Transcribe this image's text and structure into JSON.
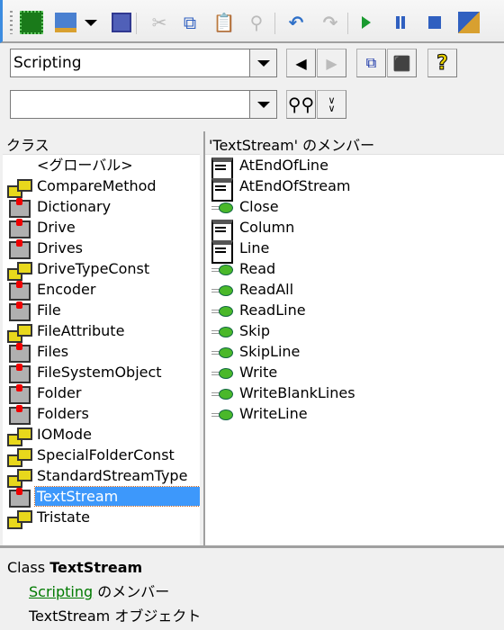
{
  "toolbar": {
    "icons": [
      "excel-icon",
      "userform-icon",
      "dropdown-icon",
      "save-icon",
      "cut-icon",
      "copy-icon",
      "paste-icon",
      "find-icon",
      "undo-icon",
      "redo-icon",
      "run-icon",
      "pause-icon",
      "stop-icon",
      "design-mode-icon"
    ]
  },
  "library_combo": {
    "value": "Scripting"
  },
  "search_combo": {
    "value": ""
  },
  "classes_header": "クラス",
  "members_header": "'TextStream' のメンバー",
  "classes": [
    {
      "label": "<グローバル>",
      "icon": "module"
    },
    {
      "label": "CompareMethod",
      "icon": "enum"
    },
    {
      "label": "Dictionary",
      "icon": "class"
    },
    {
      "label": "Drive",
      "icon": "class"
    },
    {
      "label": "Drives",
      "icon": "class"
    },
    {
      "label": "DriveTypeConst",
      "icon": "enum"
    },
    {
      "label": "Encoder",
      "icon": "class"
    },
    {
      "label": "File",
      "icon": "class"
    },
    {
      "label": "FileAttribute",
      "icon": "enum"
    },
    {
      "label": "Files",
      "icon": "class"
    },
    {
      "label": "FileSystemObject",
      "icon": "class"
    },
    {
      "label": "Folder",
      "icon": "class"
    },
    {
      "label": "Folders",
      "icon": "class"
    },
    {
      "label": "IOMode",
      "icon": "enum"
    },
    {
      "label": "SpecialFolderConst",
      "icon": "enum"
    },
    {
      "label": "StandardStreamType",
      "icon": "enum"
    },
    {
      "label": "TextStream",
      "icon": "class",
      "selected": true
    },
    {
      "label": "Tristate",
      "icon": "enum"
    }
  ],
  "members": [
    {
      "label": "AtEndOfLine",
      "icon": "prop"
    },
    {
      "label": "AtEndOfStream",
      "icon": "prop"
    },
    {
      "label": "Close",
      "icon": "meth"
    },
    {
      "label": "Column",
      "icon": "prop"
    },
    {
      "label": "Line",
      "icon": "prop"
    },
    {
      "label": "Read",
      "icon": "meth"
    },
    {
      "label": "ReadAll",
      "icon": "meth"
    },
    {
      "label": "ReadLine",
      "icon": "meth"
    },
    {
      "label": "Skip",
      "icon": "meth"
    },
    {
      "label": "SkipLine",
      "icon": "meth"
    },
    {
      "label": "Write",
      "icon": "meth"
    },
    {
      "label": "WriteBlankLines",
      "icon": "meth"
    },
    {
      "label": "WriteLine",
      "icon": "meth"
    }
  ],
  "details": {
    "kind": "Class",
    "name": "TextStream",
    "library_link": "Scripting",
    "member_of": "のメンバー",
    "description": "TextStream オブジェクト"
  },
  "colors": {
    "selection": "#3d98fb",
    "link": "#007a00"
  }
}
